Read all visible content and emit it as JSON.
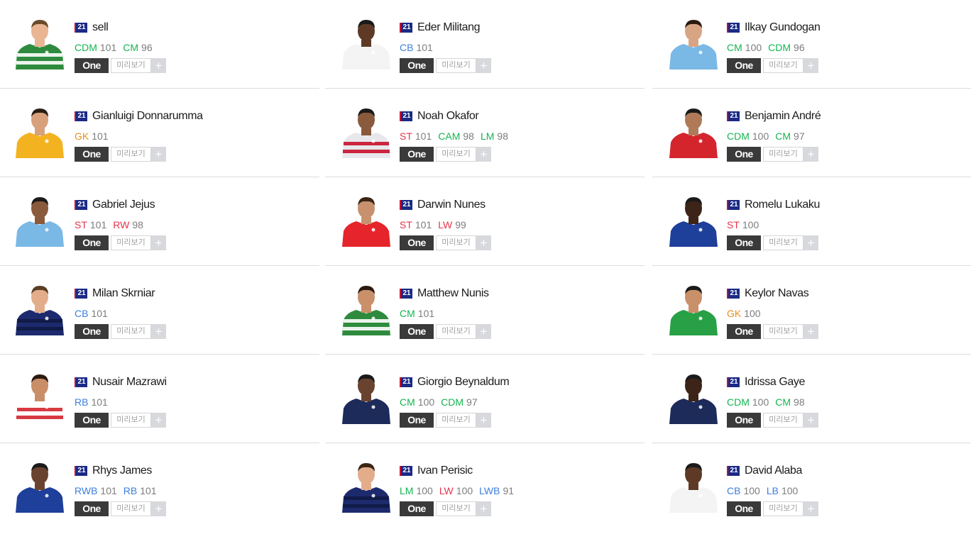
{
  "buttons": {
    "one_label": "One",
    "preview_label": "미리보기",
    "add_label": "+"
  },
  "columns": [
    [
      {
        "season": "21",
        "name": "sell",
        "positions": [
          {
            "pos": "CDM",
            "ovr": "101",
            "group": "md"
          },
          {
            "pos": "CM",
            "ovr": "96",
            "group": "md"
          }
        ],
        "kit": {
          "shirt": "#2e8b3e",
          "stripe": "#ffffff",
          "skin": "#e9b592",
          "hair": "#6a4a2a"
        }
      },
      {
        "season": "21",
        "name": "Gianluigi Donnarumma",
        "positions": [
          {
            "pos": "GK",
            "ovr": "101",
            "group": "gk"
          }
        ],
        "kit": {
          "shirt": "#f3b321",
          "stripe": "#f3b321",
          "skin": "#d9a07c",
          "hair": "#2a1d14"
        }
      },
      {
        "season": "21",
        "name": "Gabriel Jejus",
        "positions": [
          {
            "pos": "ST",
            "ovr": "101",
            "group": "st"
          },
          {
            "pos": "RW",
            "ovr": "98",
            "group": "st"
          }
        ],
        "kit": {
          "shirt": "#7ab8e6",
          "stripe": "#7ab8e6",
          "skin": "#8a5a3c",
          "hair": "#1a1a1a"
        }
      },
      {
        "season": "21",
        "name": "Milan Skrniar",
        "positions": [
          {
            "pos": "CB",
            "ovr": "101",
            "group": "df"
          }
        ],
        "kit": {
          "shirt": "#1d2a6e",
          "stripe": "#101a44",
          "skin": "#e3ad8c",
          "hair": "#5b3d24"
        }
      },
      {
        "season": "21",
        "name": "Nusair Mazrawi",
        "positions": [
          {
            "pos": "RB",
            "ovr": "101",
            "group": "df"
          }
        ],
        "kit": {
          "shirt": "#ffffff",
          "stripe": "#d4252d",
          "skin": "#c98e68",
          "hair": "#2a1a10"
        }
      },
      {
        "season": "21",
        "name": "Rhys James",
        "positions": [
          {
            "pos": "RWB",
            "ovr": "101",
            "group": "df"
          },
          {
            "pos": "RB",
            "ovr": "101",
            "group": "df"
          }
        ],
        "kit": {
          "shirt": "#1e3f9a",
          "stripe": "#1e3f9a",
          "skin": "#6a4330",
          "hair": "#1a1a1a"
        }
      }
    ],
    [
      {
        "season": "21",
        "name": "Eder Militang",
        "positions": [
          {
            "pos": "CB",
            "ovr": "101",
            "group": "df"
          }
        ],
        "kit": {
          "shirt": "#f4f4f4",
          "stripe": "#f4f4f4",
          "skin": "#5e3a26",
          "hair": "#1a1a1a"
        }
      },
      {
        "season": "21",
        "name": "Noah Okafor",
        "positions": [
          {
            "pos": "ST",
            "ovr": "101",
            "group": "st"
          },
          {
            "pos": "CAM",
            "ovr": "98",
            "group": "md"
          },
          {
            "pos": "LM",
            "ovr": "98",
            "group": "md"
          }
        ],
        "kit": {
          "shirt": "#e8e8ec",
          "stripe": "#c8102e",
          "skin": "#8a5a3c",
          "hair": "#1a1a1a"
        }
      },
      {
        "season": "21",
        "name": "Darwin Nunes",
        "positions": [
          {
            "pos": "ST",
            "ovr": "101",
            "group": "st"
          },
          {
            "pos": "LW",
            "ovr": "99",
            "group": "st"
          }
        ],
        "kit": {
          "shirt": "#e5252b",
          "stripe": "#e5252b",
          "skin": "#c7916d",
          "hair": "#3a2516"
        }
      },
      {
        "season": "21",
        "name": "Matthew Nunis",
        "positions": [
          {
            "pos": "CM",
            "ovr": "101",
            "group": "md"
          }
        ],
        "kit": {
          "shirt": "#2e8b3e",
          "stripe": "#ffffff",
          "skin": "#c9906a",
          "hair": "#2a1a10"
        }
      },
      {
        "season": "21",
        "name": "Giorgio Beynaldum",
        "positions": [
          {
            "pos": "CM",
            "ovr": "100",
            "group": "md"
          },
          {
            "pos": "CDM",
            "ovr": "97",
            "group": "md"
          }
        ],
        "kit": {
          "shirt": "#1c2b5a",
          "stripe": "#1c2b5a",
          "skin": "#6a4330",
          "hair": "#1a1a1a"
        }
      },
      {
        "season": "21",
        "name": "Ivan Perisic",
        "positions": [
          {
            "pos": "LM",
            "ovr": "100",
            "group": "md"
          },
          {
            "pos": "LW",
            "ovr": "100",
            "group": "st"
          },
          {
            "pos": "LWB",
            "ovr": "91",
            "group": "df"
          }
        ],
        "kit": {
          "shirt": "#1d2a6e",
          "stripe": "#101a44",
          "skin": "#e3ad8c",
          "hair": "#3a2516"
        }
      }
    ],
    [
      {
        "season": "21",
        "name": "Ilkay Gundogan",
        "positions": [
          {
            "pos": "CM",
            "ovr": "100",
            "group": "md"
          },
          {
            "pos": "CDM",
            "ovr": "96",
            "group": "md"
          }
        ],
        "kit": {
          "shirt": "#7ab8e6",
          "stripe": "#7ab8e6",
          "skin": "#d8a584",
          "hair": "#2a1a10"
        }
      },
      {
        "season": "21",
        "name": "Benjamin André",
        "positions": [
          {
            "pos": "CDM",
            "ovr": "100",
            "group": "md"
          },
          {
            "pos": "CM",
            "ovr": "97",
            "group": "md"
          }
        ],
        "kit": {
          "shirt": "#d4252d",
          "stripe": "#d4252d",
          "skin": "#b07a58",
          "hair": "#1a1a1a"
        }
      },
      {
        "season": "21",
        "name": "Romelu Lukaku",
        "positions": [
          {
            "pos": "ST",
            "ovr": "100",
            "group": "st"
          }
        ],
        "kit": {
          "shirt": "#1e3f9a",
          "stripe": "#1e3f9a",
          "skin": "#3d2418",
          "hair": "#1a1a1a"
        }
      },
      {
        "season": "21",
        "name": "Keylor Navas",
        "positions": [
          {
            "pos": "GK",
            "ovr": "100",
            "group": "gk"
          }
        ],
        "kit": {
          "shirt": "#27a046",
          "stripe": "#27a046",
          "skin": "#c9906a",
          "hair": "#1a1a1a"
        }
      },
      {
        "season": "21",
        "name": "Idrissa Gaye",
        "positions": [
          {
            "pos": "CDM",
            "ovr": "100",
            "group": "md"
          },
          {
            "pos": "CM",
            "ovr": "98",
            "group": "md"
          }
        ],
        "kit": {
          "shirt": "#1c2b5a",
          "stripe": "#1c2b5a",
          "skin": "#3d2418",
          "hair": "#1a1a1a"
        }
      },
      {
        "season": "21",
        "name": "David Alaba",
        "positions": [
          {
            "pos": "CB",
            "ovr": "100",
            "group": "df"
          },
          {
            "pos": "LB",
            "ovr": "100",
            "group": "df"
          }
        ],
        "kit": {
          "shirt": "#f4f4f4",
          "stripe": "#f4f4f4",
          "skin": "#5e3a26",
          "hair": "#1a1a1a"
        }
      }
    ]
  ]
}
